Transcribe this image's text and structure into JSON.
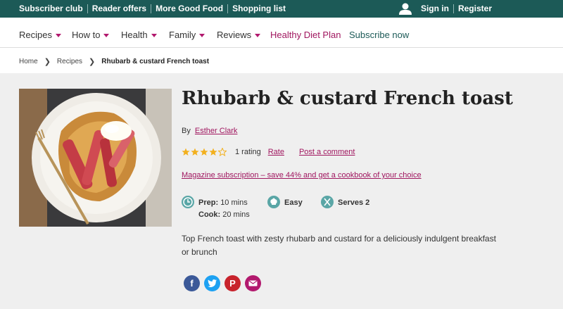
{
  "topbar": {
    "links": [
      "Subscriber club",
      "Reader offers",
      "More Good Food",
      "Shopping list"
    ],
    "sign_in": "Sign in",
    "register": "Register"
  },
  "nav": {
    "recipes": "Recipes",
    "howto": "How to",
    "health": "Health",
    "family": "Family",
    "reviews": "Reviews",
    "healthy_plan": "Healthy Diet Plan",
    "subscribe": "Subscribe now"
  },
  "breadcrumb": {
    "home": "Home",
    "recipes": "Recipes",
    "current": "Rhubarb & custard French toast"
  },
  "recipe": {
    "title": "Rhubarb & custard French toast",
    "by": "By",
    "author": "Esther Clark",
    "rating_value": 4,
    "rating_max": 5,
    "rating_count": "1 rating",
    "rate_label": "Rate",
    "comment_label": "Post a comment",
    "promo": "Magazine subscription – save 44% and get a cookbook of your choice",
    "prep_label": "Prep:",
    "prep_value": "10 mins",
    "cook_label": "Cook:",
    "cook_value": "20 mins",
    "difficulty": "Easy",
    "serves": "Serves 2",
    "description": "Top French toast with zesty rhubarb and custard for a deliciously indulgent breakfast or brunch"
  },
  "colors": {
    "brand_green": "#1c5a57",
    "accent_magenta": "#a0165f",
    "star_gold": "#f2b01e"
  },
  "icons": {
    "share": [
      "facebook-icon",
      "twitter-icon",
      "pinterest-icon",
      "email-icon"
    ]
  }
}
